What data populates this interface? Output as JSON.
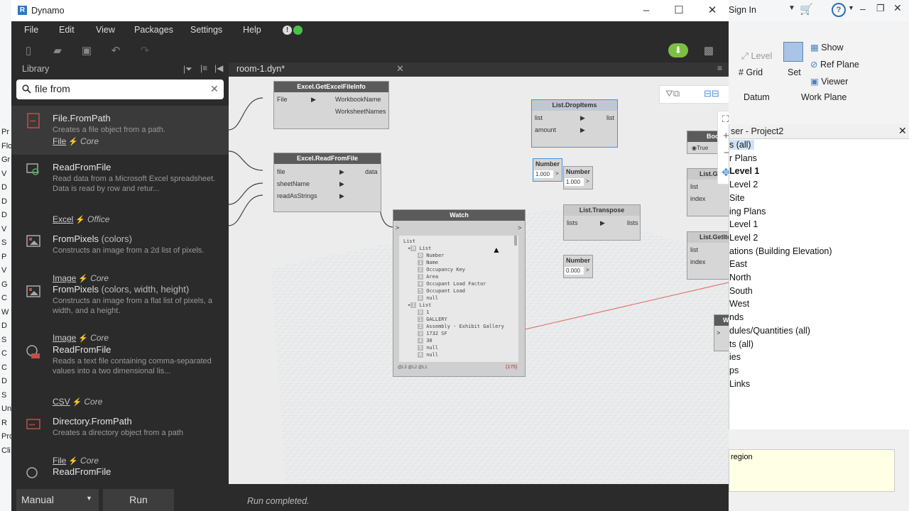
{
  "dynamo": {
    "window_title": "Dynamo",
    "menu": [
      "File",
      "Edit",
      "View",
      "Packages",
      "Settings",
      "Help"
    ],
    "library_title": "Library",
    "search_value": "file from",
    "tab_name": "room-1.dyn*",
    "results": [
      {
        "name": "File.FromPath",
        "extra": "",
        "desc": "Creates a file object from a path.",
        "category": "File",
        "library": "Core"
      },
      {
        "name": "ReadFromFile",
        "extra": "",
        "desc": "Read data from a Microsoft Excel spreadsheet. Data is read by row and retur...",
        "category": "Excel",
        "library": "Office"
      },
      {
        "name": "FromPixels",
        "extra": " (colors)",
        "desc": "Constructs an image from a 2d list of pixels.",
        "category": "Image",
        "library": "Core"
      },
      {
        "name": "FromPixels",
        "extra": " (colors, width, height)",
        "desc": "Constructs an image from a flat list of pixels, a width, and a height.",
        "category": "Image",
        "library": "Core"
      },
      {
        "name": "ReadFromFile",
        "extra": "",
        "desc": "Reads a text file containing comma-separated values into a two dimensional lis...",
        "category": "CSV",
        "library": "Core"
      },
      {
        "name": "Directory.FromPath",
        "extra": "",
        "desc": "Creates a directory object from a path",
        "category": "File",
        "library": "Core"
      },
      {
        "name": "ReadFromFile",
        "extra": "",
        "desc": "",
        "category": "",
        "library": ""
      }
    ],
    "nodes": {
      "excel_info": {
        "title": "Excel.GetExcelFileInfo",
        "in": [
          "File"
        ],
        "out": [
          "WorkbookName",
          "WorksheetNames"
        ]
      },
      "excel_read": {
        "title": "Excel.ReadFromFile",
        "in": [
          "file",
          "sheetName",
          "readAsStrings"
        ],
        "out": [
          "data"
        ]
      },
      "watch": {
        "title": "Watch",
        "root": "List",
        "footer_left": "@L3 @L2 @L1",
        "footer_right": "{175}"
      },
      "drop_items": {
        "title": "List.DropItems",
        "in": [
          "list",
          "amount"
        ],
        "out": [
          "list"
        ]
      },
      "number1": {
        "title": "Number",
        "value": "1.000"
      },
      "number2": {
        "title": "Number",
        "value": "1.000"
      },
      "transpose": {
        "title": "List.Transpose",
        "in": [
          "lists"
        ],
        "out": [
          "lists"
        ]
      },
      "number3": {
        "title": "Number",
        "value": "0.000"
      },
      "bool": {
        "title": "Boo",
        "value": "True"
      },
      "getitem1": {
        "title": "List.Ge",
        "in": [
          "list",
          "index"
        ]
      },
      "getitem2": {
        "title": "List.GetItemA",
        "in": [
          "list",
          "index"
        ]
      },
      "watch2": {
        "title": "Watc"
      }
    },
    "watch_rows": [
      {
        "indent": 1,
        "idx": "0",
        "text": "List"
      },
      {
        "indent": 2,
        "idx": "0",
        "text": "Number"
      },
      {
        "indent": 2,
        "idx": "1",
        "text": "Name"
      },
      {
        "indent": 2,
        "idx": "2",
        "text": "Occupancy Key"
      },
      {
        "indent": 2,
        "idx": "3",
        "text": "Area"
      },
      {
        "indent": 2,
        "idx": "4",
        "text": "Occupant Load Factor"
      },
      {
        "indent": 2,
        "idx": "5",
        "text": "Occupant Load"
      },
      {
        "indent": 2,
        "idx": "6",
        "text": "null"
      },
      {
        "indent": 1,
        "idx": "1",
        "text": "List"
      },
      {
        "indent": 2,
        "idx": "0",
        "text": "1"
      },
      {
        "indent": 2,
        "idx": "1",
        "text": "GALLERY"
      },
      {
        "indent": 2,
        "idx": "2",
        "text": "Assembly - Exhibit Gallery"
      },
      {
        "indent": 2,
        "idx": "3",
        "text": "1732 SF"
      },
      {
        "indent": 2,
        "idx": "4",
        "text": "30"
      },
      {
        "indent": 2,
        "idx": "5",
        "text": "null"
      },
      {
        "indent": 2,
        "idx": "6",
        "text": "null"
      }
    ],
    "run_mode": "Manual",
    "run_label": "Run",
    "run_status": "Run completed."
  },
  "revit": {
    "sign_in": "Sign In",
    "ribbon": {
      "level": "Level",
      "grid": "Grid",
      "set": "Set",
      "show": "Show",
      "ref_plane": "Ref Plane",
      "viewer": "Viewer",
      "datum": "Datum",
      "work_plane": "Work Plane"
    },
    "browser_title": "ser - Project2",
    "tree": [
      "s (all)",
      "r Plans",
      "Level 1",
      "Level 2",
      "Site",
      "ing Plans",
      "Level 1",
      "Level 2",
      "ations (Building Elevation)",
      "East",
      "North",
      "South",
      "West",
      "nds",
      "dules/Quantities (all)",
      "ts (all)",
      "ies",
      "ps",
      "Links"
    ],
    "props_text": "region",
    "left_letters": [
      "Pr",
      "Flo",
      "Gr",
      "V",
      "D",
      "D",
      "D",
      "V",
      "S",
      "P",
      "V",
      "G",
      "C",
      "W",
      "D",
      "S",
      "C",
      "C",
      "D",
      "S",
      "Un",
      "R",
      "Pro",
      "Cli"
    ]
  },
  "colors": {
    "bolt": "#d9534f",
    "accent": "#4a90d9"
  }
}
